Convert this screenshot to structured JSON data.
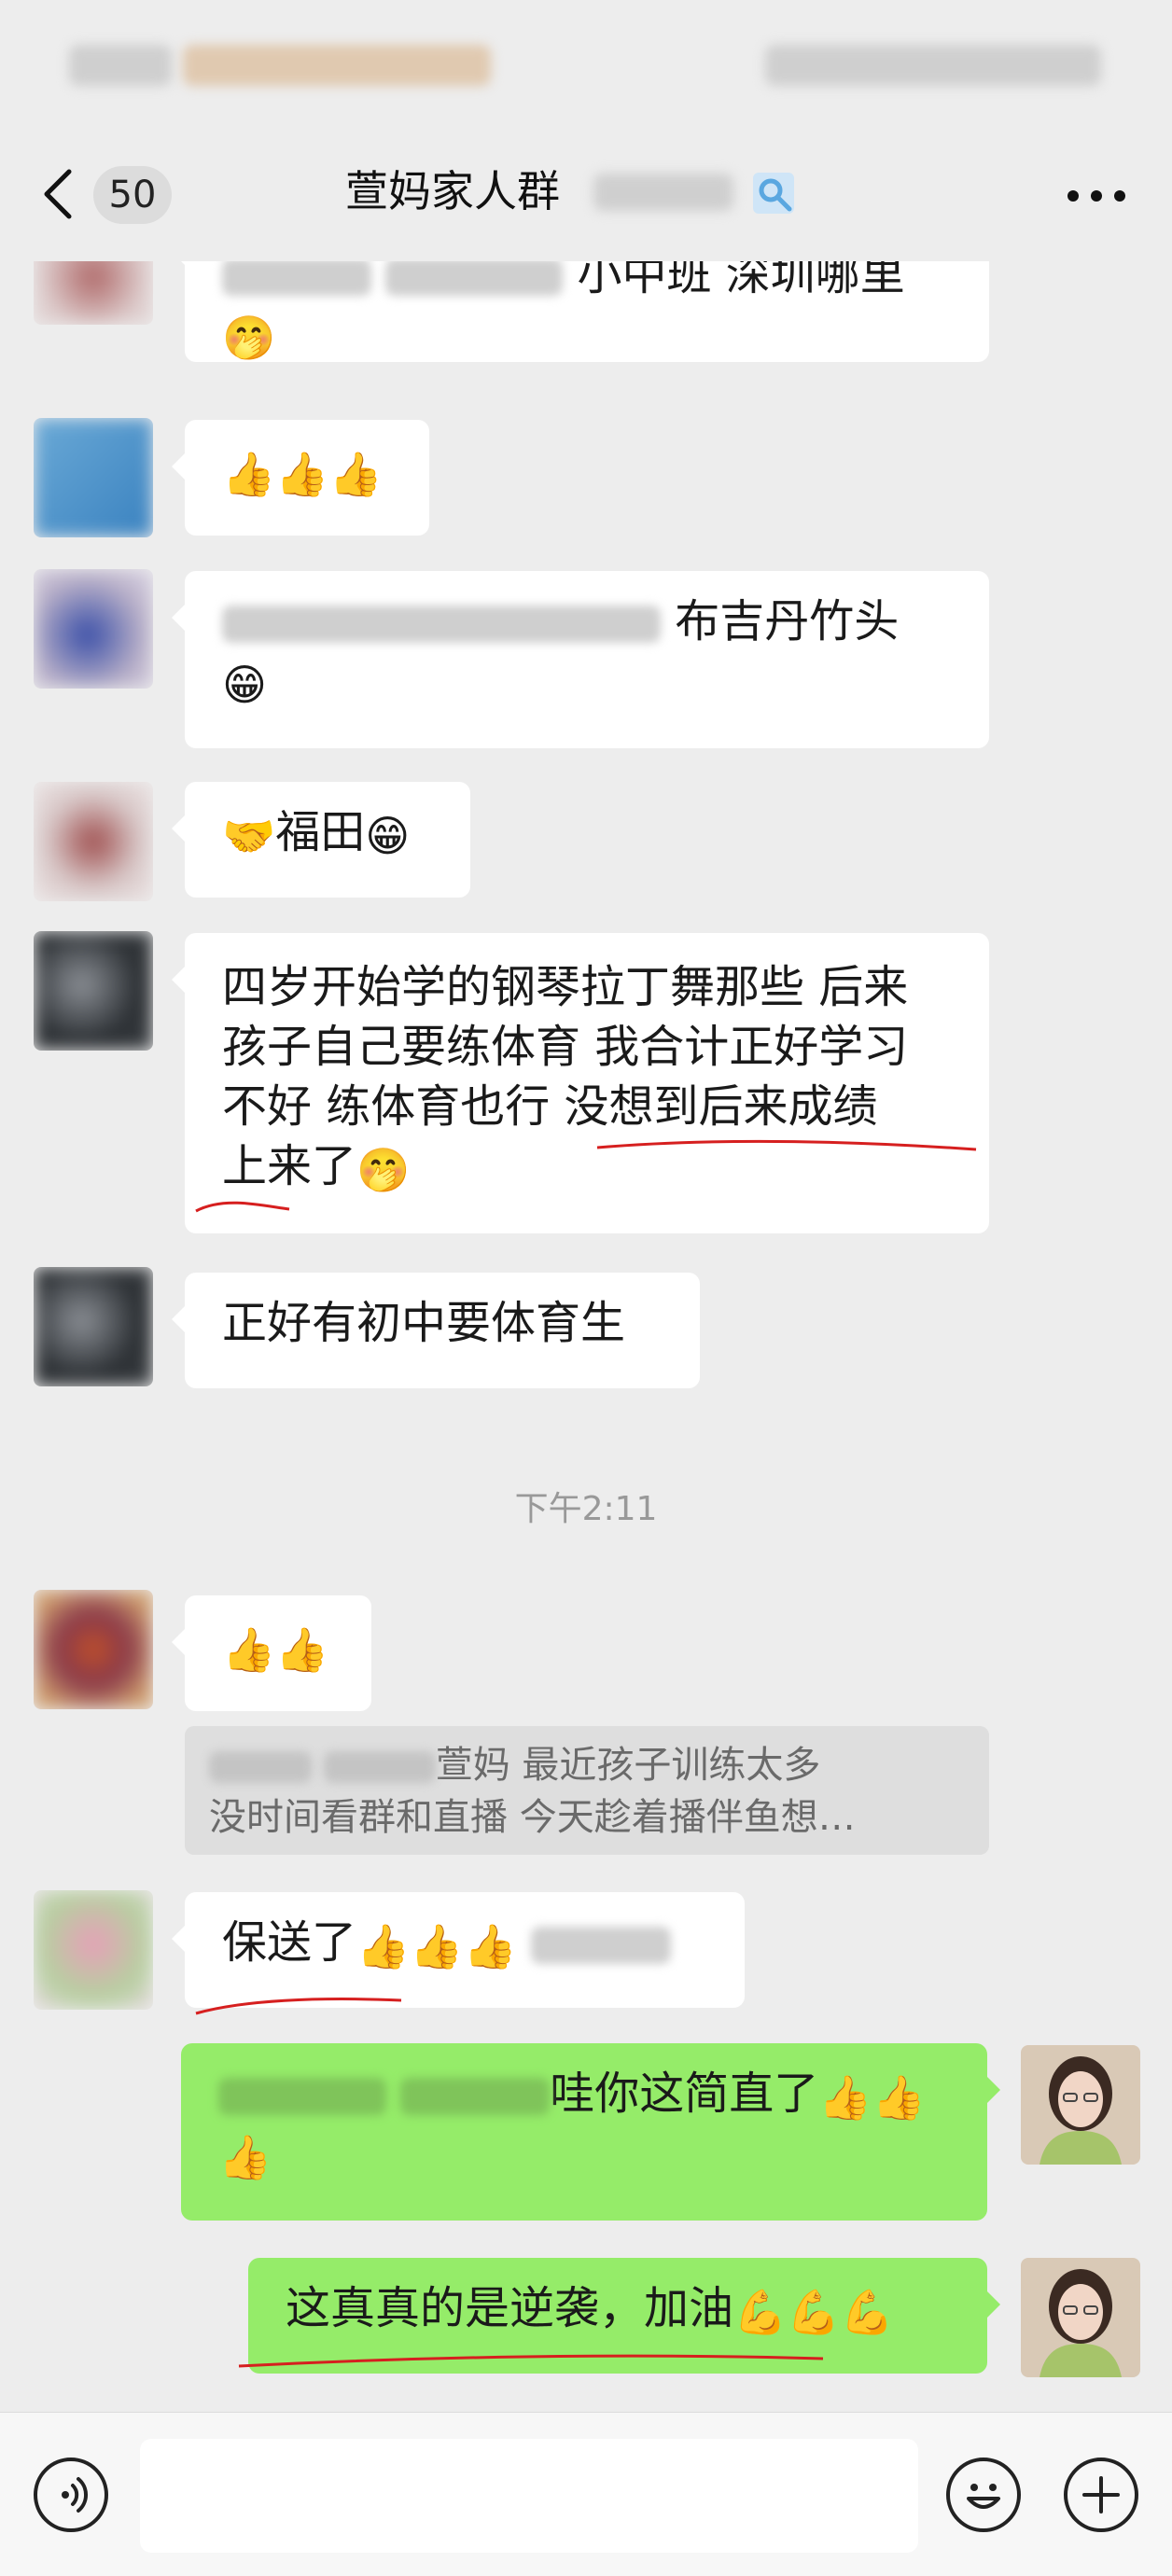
{
  "navbar": {
    "back_count": "50",
    "group_name": "萱妈家人群"
  },
  "messages": {
    "m1_text": "小中班 深圳哪里",
    "m1_emoji": "🤭",
    "m2_emoji": "👍👍👍",
    "m3_text": "布吉丹竹头",
    "m3_emoji": "😁",
    "m4_emoji_pre": "🤝",
    "m4_text": "福田",
    "m4_emoji_post": "😁",
    "m5_line1": "四岁开始学的钢琴拉丁舞那些 后来",
    "m5_line2": "孩子自己要练体育 我合计正好学习",
    "m5_line3": "不好 练体育也行 没想到后来成绩",
    "m5_line4": "上来了",
    "m5_emoji": "🤭",
    "m6_text": "正好有初中要体育生",
    "timestamp": "下午2:11",
    "m7_emoji": "👍👍",
    "quote_line1": "萱妈  最近孩子训练太多",
    "quote_line2": "没时间看群和直播  今天趁着播伴鱼想…",
    "m8_text": "保送了",
    "m8_emoji": "👍👍👍",
    "m9_text": "哇你这简直了",
    "m9_emoji": "👍👍",
    "m9_emoji2": "👍",
    "m10_text": "这真真的是逆袭，加油",
    "m10_emoji": "💪💪💪"
  },
  "colors": {
    "background": "#ededed",
    "bubble_self": "#95ec69",
    "bubble_other": "#ffffff",
    "annotation_red": "#d61f1f"
  },
  "icons": [
    "back-chevron-icon",
    "more-dots-icon",
    "voice-icon",
    "emoji-face-icon",
    "plus-icon",
    "search-box-icon"
  ]
}
